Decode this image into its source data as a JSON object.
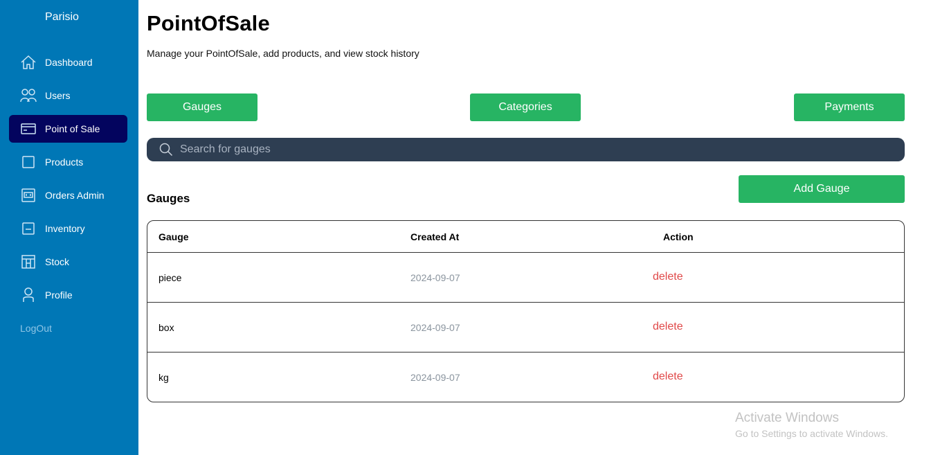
{
  "sidebar": {
    "brand": "Parisio",
    "items": [
      {
        "label": "Dashboard",
        "icon": "home-icon"
      },
      {
        "label": "Users",
        "icon": "users-icon"
      },
      {
        "label": "Point of Sale",
        "icon": "card-icon",
        "active": true
      },
      {
        "label": "Products",
        "icon": "square-icon"
      },
      {
        "label": "Orders Admin",
        "icon": "orders-icon"
      },
      {
        "label": "Inventory",
        "icon": "inventory-icon"
      },
      {
        "label": "Stock",
        "icon": "stock-icon"
      },
      {
        "label": "Profile",
        "icon": "profile-icon"
      }
    ],
    "logout": "LogOut"
  },
  "header": {
    "title": "PointOfSale",
    "subtitle": "Manage your PointOfSale, add products, and view stock history"
  },
  "tabs": {
    "gauges": "Gauges",
    "categories": "Categories",
    "payments": "Payments"
  },
  "search": {
    "placeholder": "Search for gauges",
    "value": ""
  },
  "section": {
    "title": "Gauges",
    "add_button": "Add Gauge"
  },
  "table": {
    "columns": [
      "Gauge",
      "Created At",
      "Action"
    ],
    "rows": [
      {
        "gauge": "piece",
        "created_at": "2024-09-07",
        "action": "delete"
      },
      {
        "gauge": "box",
        "created_at": "2024-09-07",
        "action": "delete"
      },
      {
        "gauge": "kg",
        "created_at": "2024-09-07",
        "action": "delete"
      }
    ]
  },
  "watermark": {
    "title": "Activate Windows",
    "subtitle": "Go to Settings to activate Windows."
  },
  "colors": {
    "sidebar_bg": "#0077b6",
    "sidebar_active": "#03045e",
    "button_green": "#27b463",
    "search_bg": "#2e3e52",
    "delete_red": "#e04848"
  }
}
